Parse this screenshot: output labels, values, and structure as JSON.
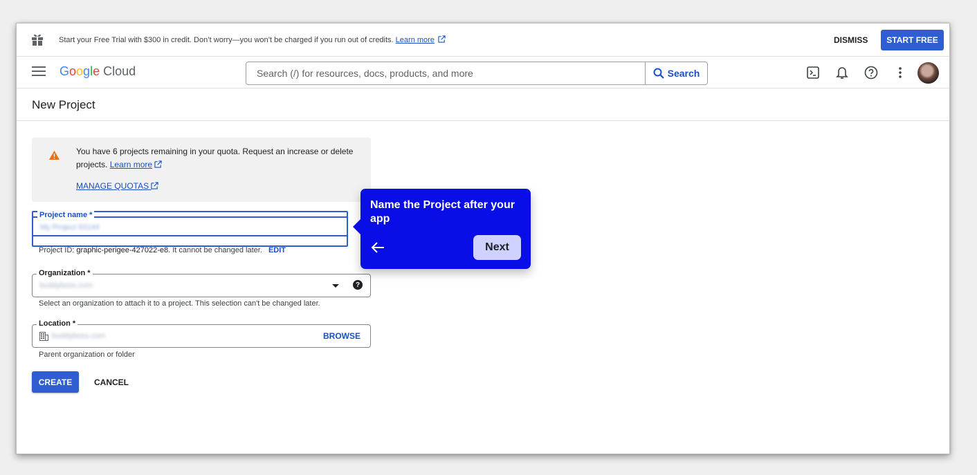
{
  "banner": {
    "message": "Start your Free Trial with $300 in credit. Don’t worry—you won’t be charged if you run out of credits.",
    "learn_more": "Learn more",
    "dismiss": "DISMISS",
    "start_free": "START FREE",
    "icon": "gift-icon"
  },
  "topnav": {
    "logo": {
      "g": "G",
      "o1": "o",
      "o2": "o",
      "g2": "g",
      "l": "l",
      "e": "e",
      "cloud": "Cloud"
    },
    "search_placeholder": "Search (/) for resources, docs, products, and more",
    "search_button": "Search",
    "icons": [
      "menu-icon",
      "cloud-shell-icon",
      "notifications-icon",
      "help-icon",
      "more-vert-icon",
      "avatar"
    ]
  },
  "page": {
    "title": "New Project"
  },
  "notice": {
    "text": "You have 6 projects remaining in your quota. Request an increase or delete projects.",
    "learn_more": "Learn more",
    "manage_quotas": "MANAGE QUOTAS"
  },
  "form": {
    "project_name": {
      "label": "Project name *",
      "value": "My Project 93144"
    },
    "project_id": {
      "prefix": "Project ID:",
      "id": "graphic-perigee-427022-e8.",
      "suffix": "It cannot be changed later.",
      "edit": "EDIT"
    },
    "organization": {
      "label": "Organization *",
      "value": "buddyboss.com",
      "helper": "Select an organization to attach it to a project. This selection can't be changed later."
    },
    "location": {
      "label": "Location *",
      "value": "buddyboss.com",
      "browse": "BROWSE",
      "helper": "Parent organization or folder"
    },
    "create": "CREATE",
    "cancel": "CANCEL"
  },
  "tooltip": {
    "text": "Name the Project after your app",
    "next": "Next"
  },
  "colors": {
    "accent": "#2f5ed1",
    "tooltip": "#0a0ee6",
    "warning": "#e8710a"
  }
}
